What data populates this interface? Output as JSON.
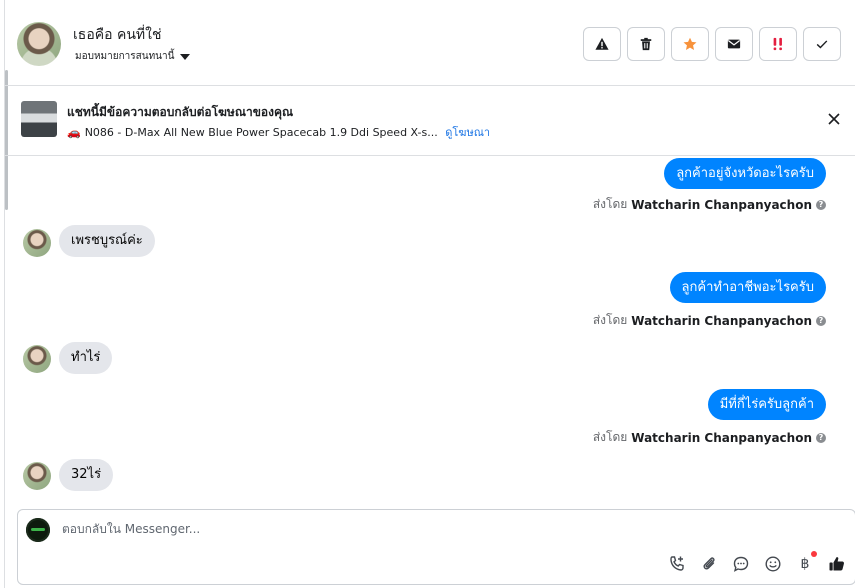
{
  "header": {
    "contact_name": "เธอคือ คนที่ใช่",
    "assign_label": "มอบหมายการสนทนานี้",
    "actions": [
      {
        "name": "mark-spam-button",
        "icon": "warning-icon"
      },
      {
        "name": "delete-button",
        "icon": "trash-icon"
      },
      {
        "name": "star-button",
        "icon": "star-icon"
      },
      {
        "name": "mark-unread-button",
        "icon": "envelope-icon"
      },
      {
        "name": "follow-up-button",
        "icon": "follow-up-icon"
      },
      {
        "name": "mark-done-button",
        "icon": "check-icon"
      }
    ]
  },
  "ad": {
    "title": "แชทนี้มีข้อความตอบกลับต่อโฆษณาของคุณ",
    "product": "N086 - D-Max All New Blue Power Spacecab 1.9 Ddi Speed X-s...",
    "link": "ดูโฆษณา"
  },
  "messages": {
    "out1": "ลูกค้าอยู่จังหวัดอะไรครับ",
    "in1": "เพรชบูรณ์ค่ะ",
    "out2": "ลูกค้าทำอาชีพอะไรครับ",
    "in2": "ทำไร่",
    "out3": "มีที่กี่ไร่ครับลูกค้า",
    "in3": "32ไร่",
    "sent_by_prefix": "ส่งโดย",
    "sent_by_name": "Watcharin Chanpanyachon"
  },
  "composer": {
    "placeholder": "ตอบกลับใน Messenger...",
    "baht_symbol": "฿"
  },
  "colors": {
    "accent": "#0084ff",
    "incoming": "#e4e6eb",
    "star": "#f7923b",
    "follow_up": "#e41e3f"
  }
}
